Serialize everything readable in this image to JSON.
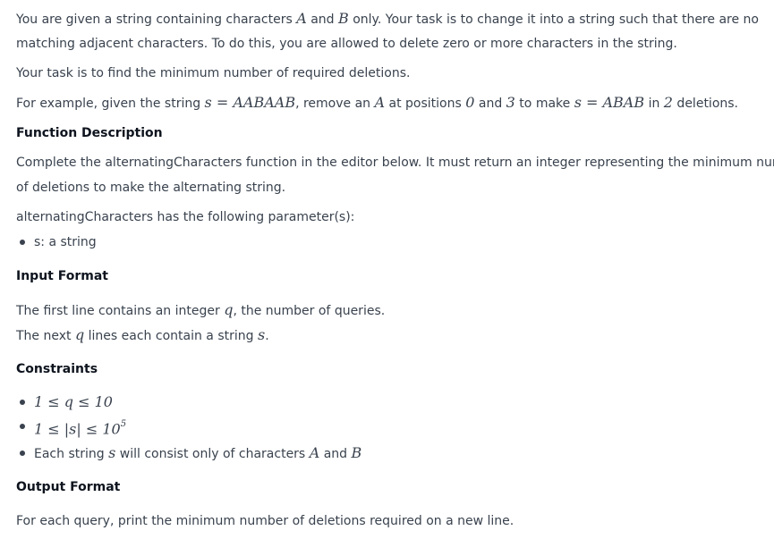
{
  "intro": {
    "line1_a": "You are given a string containing characters ",
    "var_A": "A",
    "and": " and ",
    "var_B": "B",
    "line1_b": " only. Your task is to change it into a string such that there are no",
    "line2": "matching adjacent characters. To do this, you are allowed to delete zero or more characters in the string."
  },
  "task": "Your task is to find the minimum number of required deletions.",
  "example": {
    "prefix": "For example, given the string ",
    "eq1": "s = AABAAB",
    "mid1": ", remove an ",
    "var_A": "A",
    "mid2": " at positions ",
    "pos0": "0",
    "and": " and ",
    "pos3": "3",
    "mid3": " to make ",
    "eq2": "s = ABAB",
    "mid4": " in ",
    "count": "2",
    "suffix": " deletions."
  },
  "function_description": {
    "heading": "Function Description",
    "line1": "Complete the alternatingCharacters function in the editor below. It must return an integer representing the minimum number",
    "line2": "of deletions to make the alternating string.",
    "params_intro": "alternatingCharacters has the following parameter(s):",
    "params": [
      "s: a string"
    ]
  },
  "input_format": {
    "heading": "Input Format",
    "line1_a": "The first line contains an integer ",
    "line1_var": "q",
    "line1_b": ", the number of queries.",
    "line2_a": "The next ",
    "line2_var": "q",
    "line2_b": " lines each contain a string ",
    "line2_var2": "s",
    "line2_c": "."
  },
  "constraints": {
    "heading": "Constraints",
    "c1": "1 ≤ q ≤ 10",
    "c2_a": "1 ≤ |s| ≤ 10",
    "c2_exp": "5",
    "c3_a": "Each string ",
    "c3_var": "s",
    "c3_b": " will consist only of characters ",
    "c3_A": "A",
    "c3_and": " and ",
    "c3_B": "B"
  },
  "output_format": {
    "heading": "Output Format",
    "line": "For each query, print the minimum number of deletions required on a new line."
  }
}
